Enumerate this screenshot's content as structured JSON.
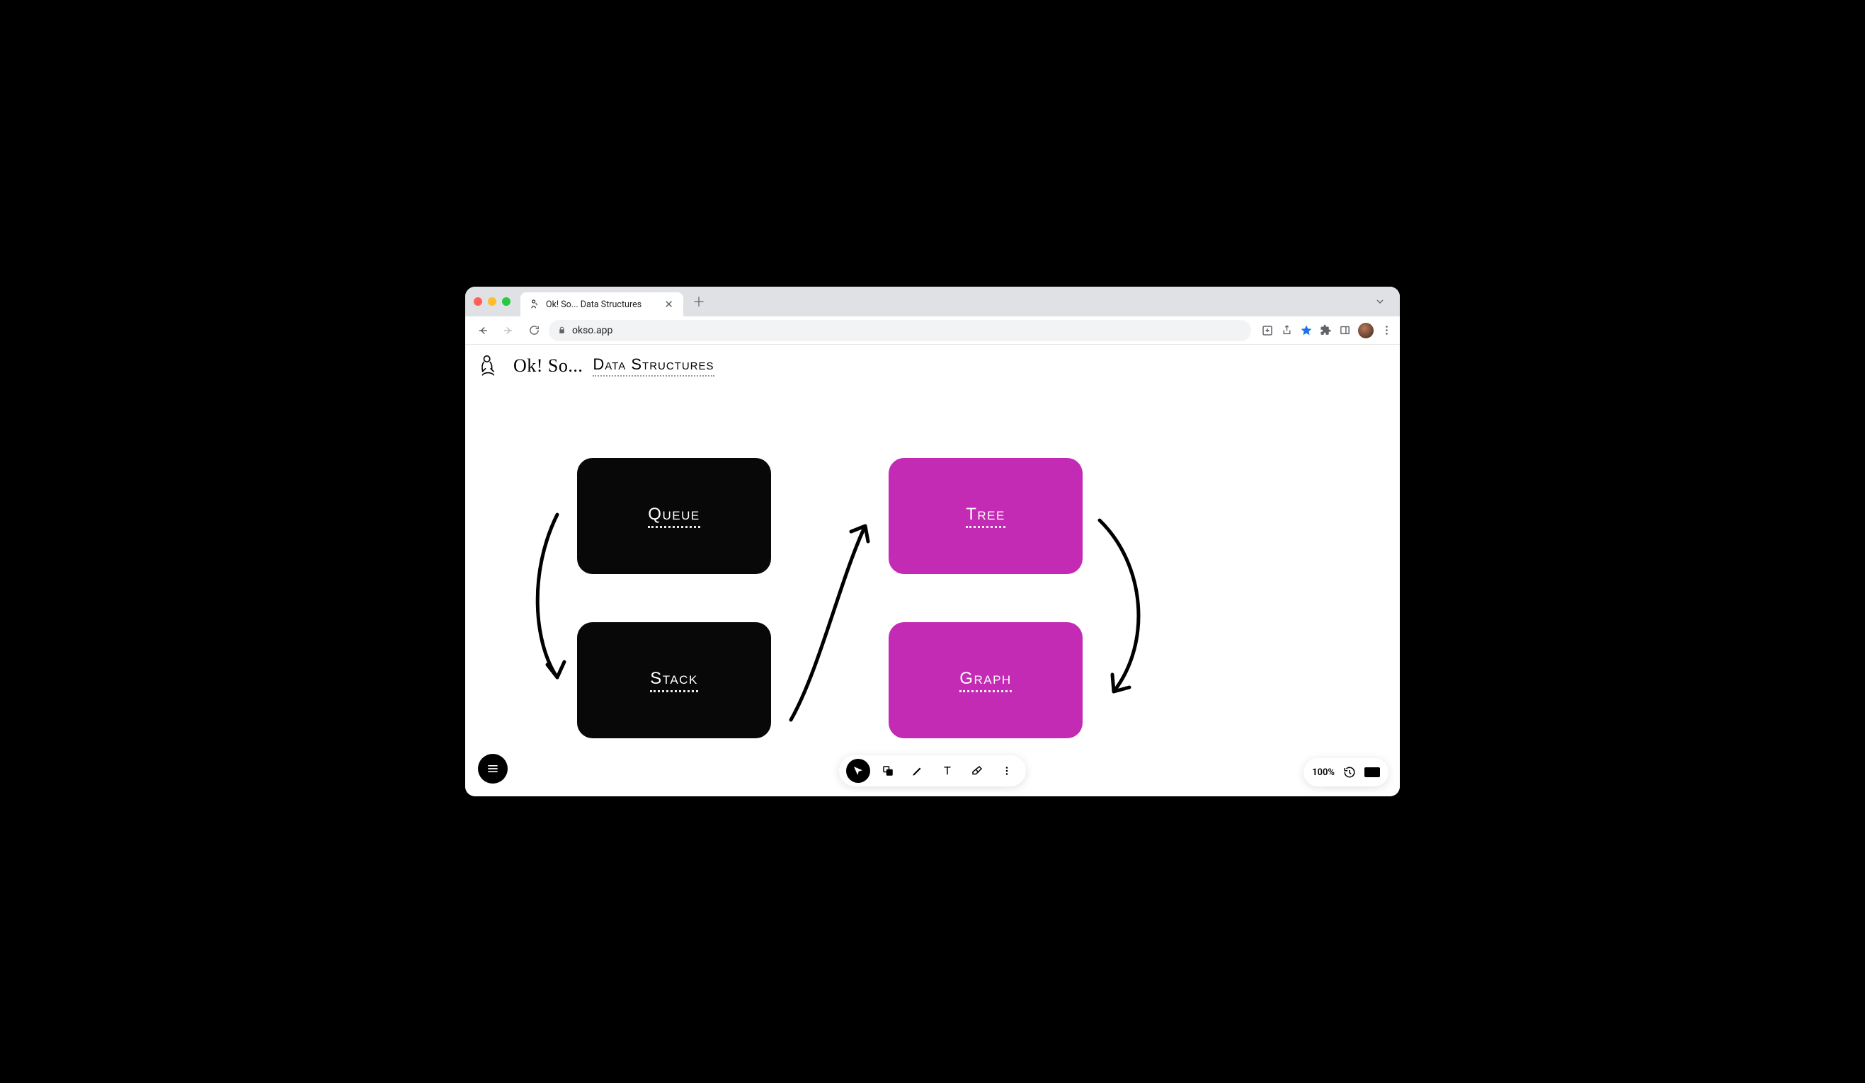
{
  "browser": {
    "tab": {
      "title": "Ok! So... Data Structures"
    },
    "url": "okso.app"
  },
  "app": {
    "brand": "Ok! So...",
    "document_title": "Data Structures"
  },
  "nodes": {
    "queue": "Queue",
    "stack": "Stack",
    "tree": "Tree",
    "graph": "Graph"
  },
  "colors": {
    "node_black": "#080808",
    "node_magenta": "#c42bb5"
  },
  "bottom_right": {
    "zoom": "100%"
  }
}
